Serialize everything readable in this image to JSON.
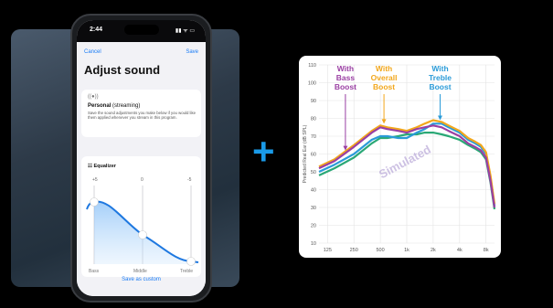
{
  "phone": {
    "status_time": "2:44",
    "status_icons": "▮▮ ᯤ ▭",
    "nav": {
      "cancel_label": "Cancel",
      "save_label": "Save"
    },
    "page_title": "Adjust sound",
    "personal_card": {
      "icon": "((●))",
      "title": "Personal",
      "subtitle": "(streaming)",
      "description": "Save the sound adjustments you make below if you would like them applied whenever you stream in this program."
    },
    "equalizer": {
      "title": "Equalizer",
      "scale": [
        "+5",
        "0",
        "-5"
      ],
      "bands": [
        "Bass",
        "Middle",
        "Treble"
      ],
      "knob_levels": [
        0.8,
        0.5,
        0.1
      ]
    },
    "save_custom_label": "Save as custom"
  },
  "plus_symbol": "+",
  "chart_data": {
    "type": "line",
    "title": "",
    "xlabel": "",
    "ylabel": "Predicted Real Ear (dB SPL)",
    "x_scale": "log",
    "xlim": [
      100,
      10000
    ],
    "ylim": [
      10,
      110
    ],
    "x_ticks": [
      125,
      250,
      500,
      1000,
      2000,
      4000,
      8000
    ],
    "x_tick_labels": [
      "125",
      "250",
      "500",
      "1k",
      "2k",
      "4k",
      "8k"
    ],
    "y_ticks": [
      10,
      20,
      30,
      40,
      50,
      60,
      70,
      80,
      90,
      100,
      110
    ],
    "grid": true,
    "watermark": "Simulated",
    "x": [
      100,
      150,
      250,
      400,
      500,
      600,
      800,
      1000,
      1300,
      1600,
      2000,
      2500,
      3000,
      4000,
      5000,
      6000,
      7000,
      8000,
      9000,
      10000
    ],
    "series": [
      {
        "name": "With Bass Boost",
        "color": "#9a3fa3",
        "values": [
          52,
          56,
          64,
          72,
          75,
          74,
          73,
          72,
          74,
          75,
          76,
          75,
          73,
          70,
          66,
          64,
          62,
          58,
          45,
          30
        ]
      },
      {
        "name": "With Overall Boost",
        "color": "#f2a71c",
        "values": [
          53,
          57,
          65,
          73,
          76,
          75,
          74,
          73,
          75,
          77,
          79,
          78,
          76,
          73,
          69,
          67,
          65,
          61,
          48,
          32
        ]
      },
      {
        "name": "With Treble Boost",
        "color": "#2a9bd8",
        "values": [
          50,
          54,
          60,
          68,
          70,
          70,
          69,
          69,
          72,
          74,
          77,
          77,
          75,
          72,
          68,
          66,
          64,
          60,
          47,
          31
        ]
      },
      {
        "name": "",
        "color": "#2aa876",
        "values": [
          48,
          52,
          58,
          66,
          69,
          69,
          70,
          71,
          71,
          72,
          72,
          71,
          70,
          68,
          65,
          63,
          61,
          57,
          44,
          29
        ]
      }
    ],
    "annotations": [
      {
        "text": [
          "With",
          "Bass",
          "Boost"
        ],
        "color": "#9a3fa3",
        "x": 200,
        "arrow_to": 62
      },
      {
        "text": [
          "With",
          "Overall",
          "Boost"
        ],
        "color": "#f2a71c",
        "x": 550,
        "arrow_to": 77
      },
      {
        "text": [
          "With",
          "Treble",
          "Boost"
        ],
        "color": "#2a9bd8",
        "x": 2400,
        "arrow_to": 79
      }
    ]
  }
}
